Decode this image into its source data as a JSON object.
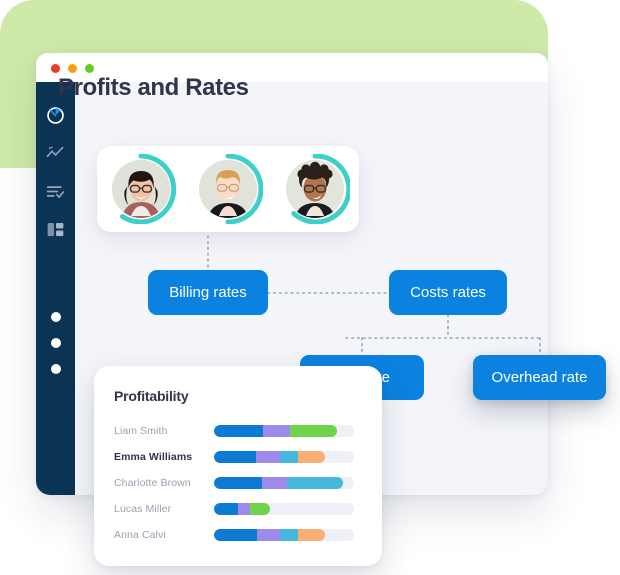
{
  "window": {
    "traffic_lights": [
      {
        "name": "close",
        "color": "#ec3b2c"
      },
      {
        "name": "minimize",
        "color": "#ff9e0d"
      },
      {
        "name": "maximize",
        "color": "#62cc28"
      }
    ]
  },
  "backdrop": {
    "color": "#cfe9a9"
  },
  "sidebar": {
    "background": "#0b3354",
    "items": [
      {
        "icon": "donut-chart-icon",
        "active": true
      },
      {
        "icon": "analytics-line-icon",
        "active": false
      },
      {
        "icon": "checklist-icon",
        "active": false
      },
      {
        "icon": "dashboard-layout-icon",
        "active": false
      }
    ],
    "dots": [
      {
        "icon": "nav-dot-icon"
      },
      {
        "icon": "nav-dot-icon"
      },
      {
        "icon": "nav-dot-icon"
      }
    ]
  },
  "header": {
    "title": "Profits and Rates"
  },
  "avatars": {
    "ring_color": "#3fcfc9",
    "people": [
      {
        "name": "avatar-person-1",
        "ring_sweep": 255
      },
      {
        "name": "avatar-person-2",
        "ring_sweep": 180
      },
      {
        "name": "avatar-person-3",
        "ring_sweep": 265
      }
    ]
  },
  "flow": {
    "node_color": "#0b82e0",
    "connector_color": "#9aa2b1",
    "nodes": [
      {
        "id": "billing",
        "label": "Billing rates"
      },
      {
        "id": "costs",
        "label": "Costs rates"
      },
      {
        "id": "pay",
        "label": "Pay rate"
      },
      {
        "id": "overhead",
        "label": "Overhead rate"
      }
    ]
  },
  "profitability": {
    "title": "Profitability",
    "palette": {
      "blue": "#0d7bd4",
      "purple": "#9d8aea",
      "green": "#6ed44a",
      "teal": "#45b8dc",
      "orange": "#f9ae74",
      "track": "#eef0f6"
    },
    "rows": [
      {
        "name": "Liam  Smith",
        "highlighted": false,
        "segments": [
          {
            "color": "#0d7bd4",
            "pct": 35
          },
          {
            "color": "#9d8aea",
            "pct": 19
          },
          {
            "color": "#6ed44a",
            "pct": 34
          }
        ]
      },
      {
        "name": "Emma Williams",
        "highlighted": true,
        "segments": [
          {
            "color": "#0d7bd4",
            "pct": 30
          },
          {
            "color": "#9d8aea",
            "pct": 17
          },
          {
            "color": "#45b8dc",
            "pct": 13
          },
          {
            "color": "#f9ae74",
            "pct": 19
          }
        ]
      },
      {
        "name": "Charlotte  Brown",
        "highlighted": false,
        "segments": [
          {
            "color": "#0d7bd4",
            "pct": 34
          },
          {
            "color": "#9d8aea",
            "pct": 18
          },
          {
            "color": "#45b8dc",
            "pct": 40
          }
        ]
      },
      {
        "name": "Lucas Miller",
        "highlighted": false,
        "segments": [
          {
            "color": "#0d7bd4",
            "pct": 17
          },
          {
            "color": "#9d8aea",
            "pct": 9
          },
          {
            "color": "#6ed44a",
            "pct": 14
          }
        ]
      },
      {
        "name": "Anna Calvi",
        "highlighted": false,
        "segments": [
          {
            "color": "#0d7bd4",
            "pct": 31
          },
          {
            "color": "#9d8aea",
            "pct": 16
          },
          {
            "color": "#45b8dc",
            "pct": 13
          },
          {
            "color": "#f9ae74",
            "pct": 19
          }
        ]
      }
    ]
  }
}
